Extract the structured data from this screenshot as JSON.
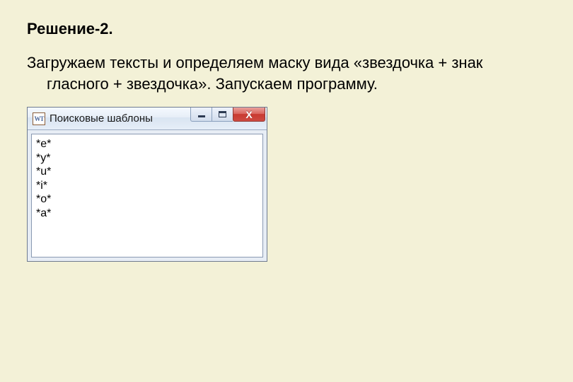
{
  "heading": "Решение-2.",
  "description_line1": "Загружаем тексты и определяем маску вида «звездочка + знак",
  "description_line2": "гласного + звездочка». Запускаем программу.",
  "window": {
    "app_icon_text": "WT",
    "title": "Поисковые шаблоны",
    "close_glyph": "X",
    "patterns": [
      "*e*",
      "*y*",
      "*u*",
      "*i*",
      "*o*",
      "*a*"
    ]
  }
}
